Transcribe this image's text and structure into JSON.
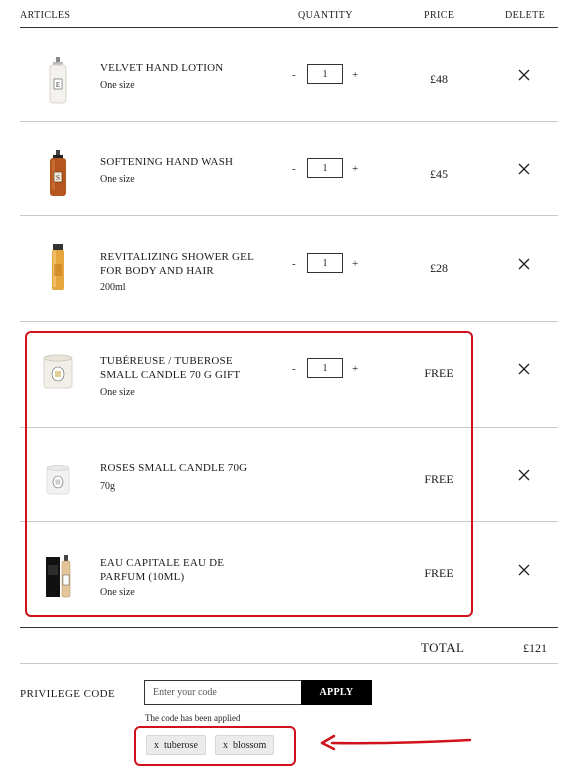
{
  "header": {
    "articles": "ARTICLES",
    "quantity": "QUANTITY",
    "price": "PRICE",
    "delete": "DELETE"
  },
  "items": [
    {
      "name": "VELVET HAND LOTION",
      "size": "One size",
      "qty": "1",
      "price": "£48",
      "image": "lotion-bottle"
    },
    {
      "name": "SOFTENING HAND WASH",
      "size": "One size",
      "qty": "1",
      "price": "£45",
      "image": "hand-wash-bottle"
    },
    {
      "name": "REVITALIZING SHOWER GEL FOR BODY AND HAIR",
      "size": "200ml",
      "qty": "1",
      "price": "£28",
      "image": "shower-gel-tube"
    },
    {
      "name": "TUBÉREUSE / TUBEROSE SMALL CANDLE 70 G GIFT",
      "size": "One size",
      "qty": "1",
      "price": "FREE",
      "image": "candle"
    },
    {
      "name": "ROSES SMALL CANDLE 70G",
      "size": "70g",
      "price": "FREE",
      "image": "candle"
    },
    {
      "name": "EAU CAPITALE EAU DE PARFUM (10ML)",
      "size": "One size",
      "price": "FREE",
      "image": "perfume-box"
    }
  ],
  "stepper": {
    "minus": "-",
    "plus": "+"
  },
  "delete_icon": "close-icon",
  "total": {
    "label": "TOTAL",
    "value": "£121"
  },
  "privilege": {
    "label": "PRIVILEGE CODE",
    "placeholder": "Enter your code",
    "apply_label": "APPLY",
    "status": "The code has been applied",
    "codes": [
      {
        "remove": "x",
        "code": "tuberose"
      },
      {
        "remove": "x",
        "code": "blossom"
      }
    ]
  },
  "annotation_color": "#d0121c"
}
